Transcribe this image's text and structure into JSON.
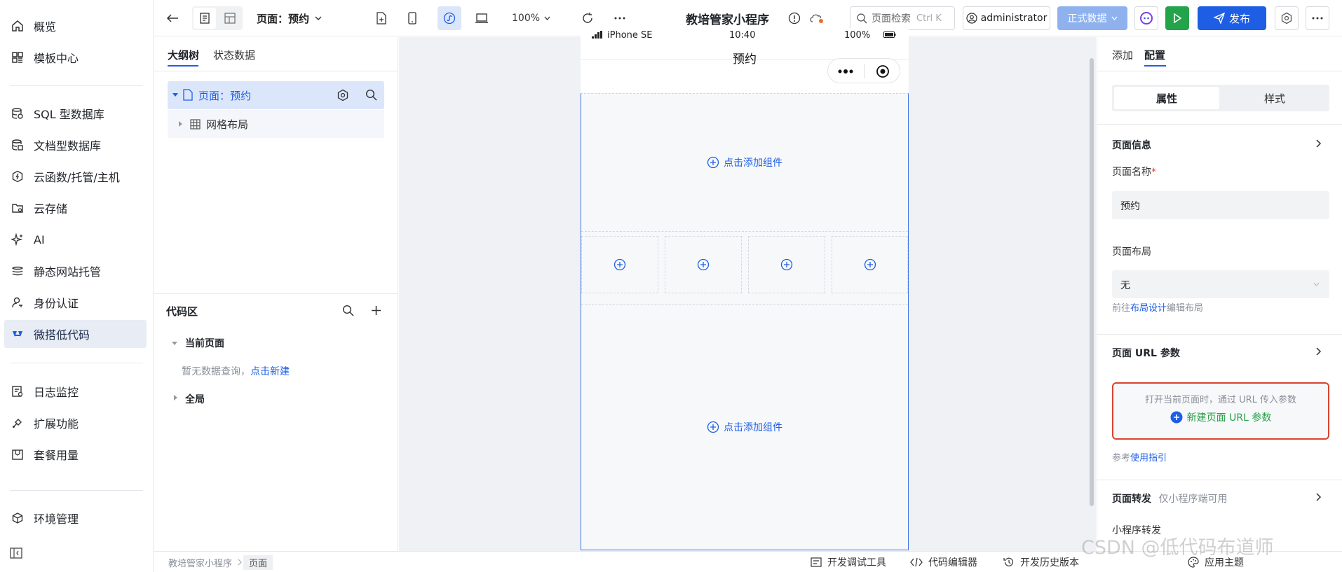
{
  "sidebar": {
    "items": [
      {
        "label": "概览",
        "icon": "home-icon"
      },
      {
        "label": "模板中心",
        "icon": "grid-icon"
      },
      {
        "label": "SQL 型数据库",
        "icon": "database-icon"
      },
      {
        "label": "文档型数据库",
        "icon": "document-db-icon"
      },
      {
        "label": "云函数/托管/主机",
        "icon": "hexagon-icon"
      },
      {
        "label": "云存储",
        "icon": "folder-icon"
      },
      {
        "label": "AI",
        "icon": "sparkle-icon"
      },
      {
        "label": "静态网站托管",
        "icon": "layers-icon"
      },
      {
        "label": "身份认证",
        "icon": "user-key-icon"
      },
      {
        "label": "微搭低代码",
        "icon": "lowcode-icon"
      },
      {
        "label": "日志监控",
        "icon": "log-icon"
      },
      {
        "label": "扩展功能",
        "icon": "extension-icon"
      },
      {
        "label": "套餐用量",
        "icon": "package-icon"
      },
      {
        "label": "环境管理",
        "icon": "environment-icon"
      }
    ],
    "active_index": 9
  },
  "toolbar": {
    "page_select": "页面：预约",
    "zoom": "100%",
    "app_title": "教培管家小程序",
    "search_placeholder": "页面检索",
    "search_shortcut": "Ctrl K",
    "user": "administrator",
    "data_mode": "正式数据",
    "publish": "发布"
  },
  "outline": {
    "tabs": [
      "大纲树",
      "状态数据"
    ],
    "tree_root": "页面：预约",
    "tree_child": "网格布局"
  },
  "code_area": {
    "title": "代码区",
    "current_page": "当前页面",
    "empty_text": "暂无数据查询，",
    "create_link": "点击新建",
    "global": "全局"
  },
  "phone": {
    "device": "iPhone SE",
    "time": "10:40",
    "battery": "100%",
    "page_title": "预约",
    "add_component": "点击添加组件"
  },
  "right_panel": {
    "tabs": [
      "添加",
      "配置"
    ],
    "segment": [
      "属性",
      "样式"
    ],
    "page_info": "页面信息",
    "page_name_label": "页面名称",
    "required_mark": "*",
    "page_name_value": "预约",
    "page_layout_label": "页面布局",
    "page_layout_value": "无",
    "layout_hint_prefix": "前往",
    "layout_hint_link": "布局设计",
    "layout_hint_suffix": "编辑布局",
    "url_params_title": "页面 URL 参数",
    "url_params_desc": "打开当前页面时，通过 URL 传入参数",
    "new_url_param": "新建页面 URL 参数",
    "guide_prefix": "参考",
    "guide_link": "使用指引",
    "forward_title": "页面转发",
    "forward_note": "仅小程序端可用",
    "mini_forward": "小程序转发"
  },
  "statusbar": {
    "breadcrumb": [
      "教培管家小程序",
      "页面"
    ],
    "debug_tools": "开发调试工具",
    "code_editor": "代码编辑器",
    "history": "开发历史版本",
    "theme": "应用主题"
  },
  "watermark": "CSDN @低代码布道师",
  "colors": {
    "accent": "#1e5ee5",
    "highlight_border": "#d9452f",
    "green": "#2aa04a"
  }
}
